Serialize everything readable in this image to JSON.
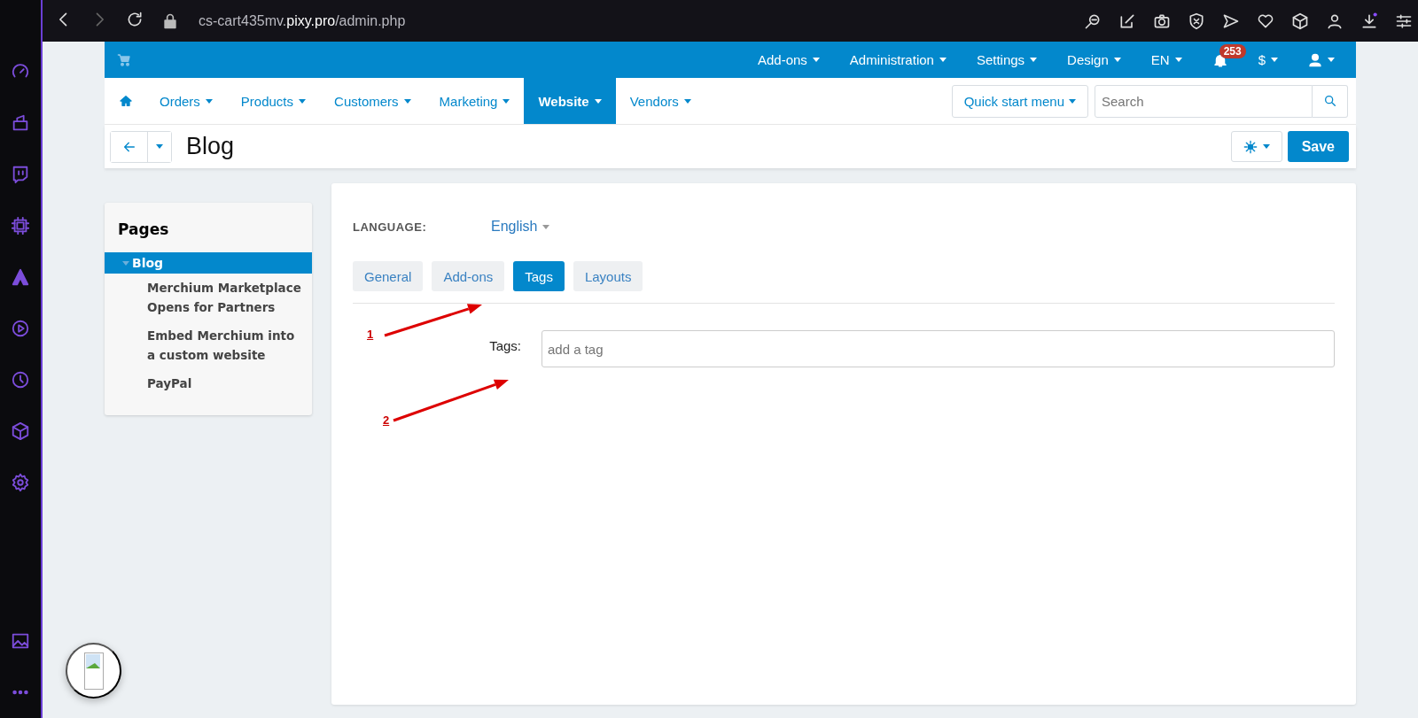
{
  "browser": {
    "url": "cs-cart435mv.**pixy.pro**/admin.php"
  },
  "top_menu": [
    {
      "label": "Add-ons"
    },
    {
      "label": "Administration"
    },
    {
      "label": "Settings"
    },
    {
      "label": "Design"
    },
    {
      "label": "EN"
    }
  ],
  "notifications": {
    "count": "253"
  },
  "currency": {
    "label": "$"
  },
  "nav": [
    {
      "label": "Orders",
      "selected": false
    },
    {
      "label": "Products",
      "selected": false
    },
    {
      "label": "Customers",
      "selected": false
    },
    {
      "label": "Marketing",
      "selected": false
    },
    {
      "label": "Website",
      "selected": true
    },
    {
      "label": "Vendors",
      "selected": false
    }
  ],
  "quick_start": {
    "label": "Quick start menu"
  },
  "search": {
    "placeholder": "Search"
  },
  "page": {
    "title": "Blog",
    "save": "Save"
  },
  "sidebar": {
    "title": "Pages",
    "items": [
      {
        "label": "Blog",
        "selected": true,
        "expanded": true,
        "children": [
          {
            "label": "Merchium Marketplace Opens for Partners",
            "selected": false
          },
          {
            "label": "Embed Merchium into a custom website",
            "selected": false
          },
          {
            "label": "PayPal",
            "selected": false
          }
        ]
      }
    ]
  },
  "language": {
    "label": "LANGUAGE:",
    "value": "English"
  },
  "tabs": [
    {
      "label": "General",
      "selected": false
    },
    {
      "label": "Add-ons",
      "selected": false
    },
    {
      "label": "Tags",
      "selected": true
    },
    {
      "label": "Layouts",
      "selected": false
    }
  ],
  "tags_field": {
    "label": "Tags:",
    "placeholder": "add a tag"
  },
  "annotations": [
    {
      "label": "1"
    },
    {
      "label": "2"
    }
  ]
}
